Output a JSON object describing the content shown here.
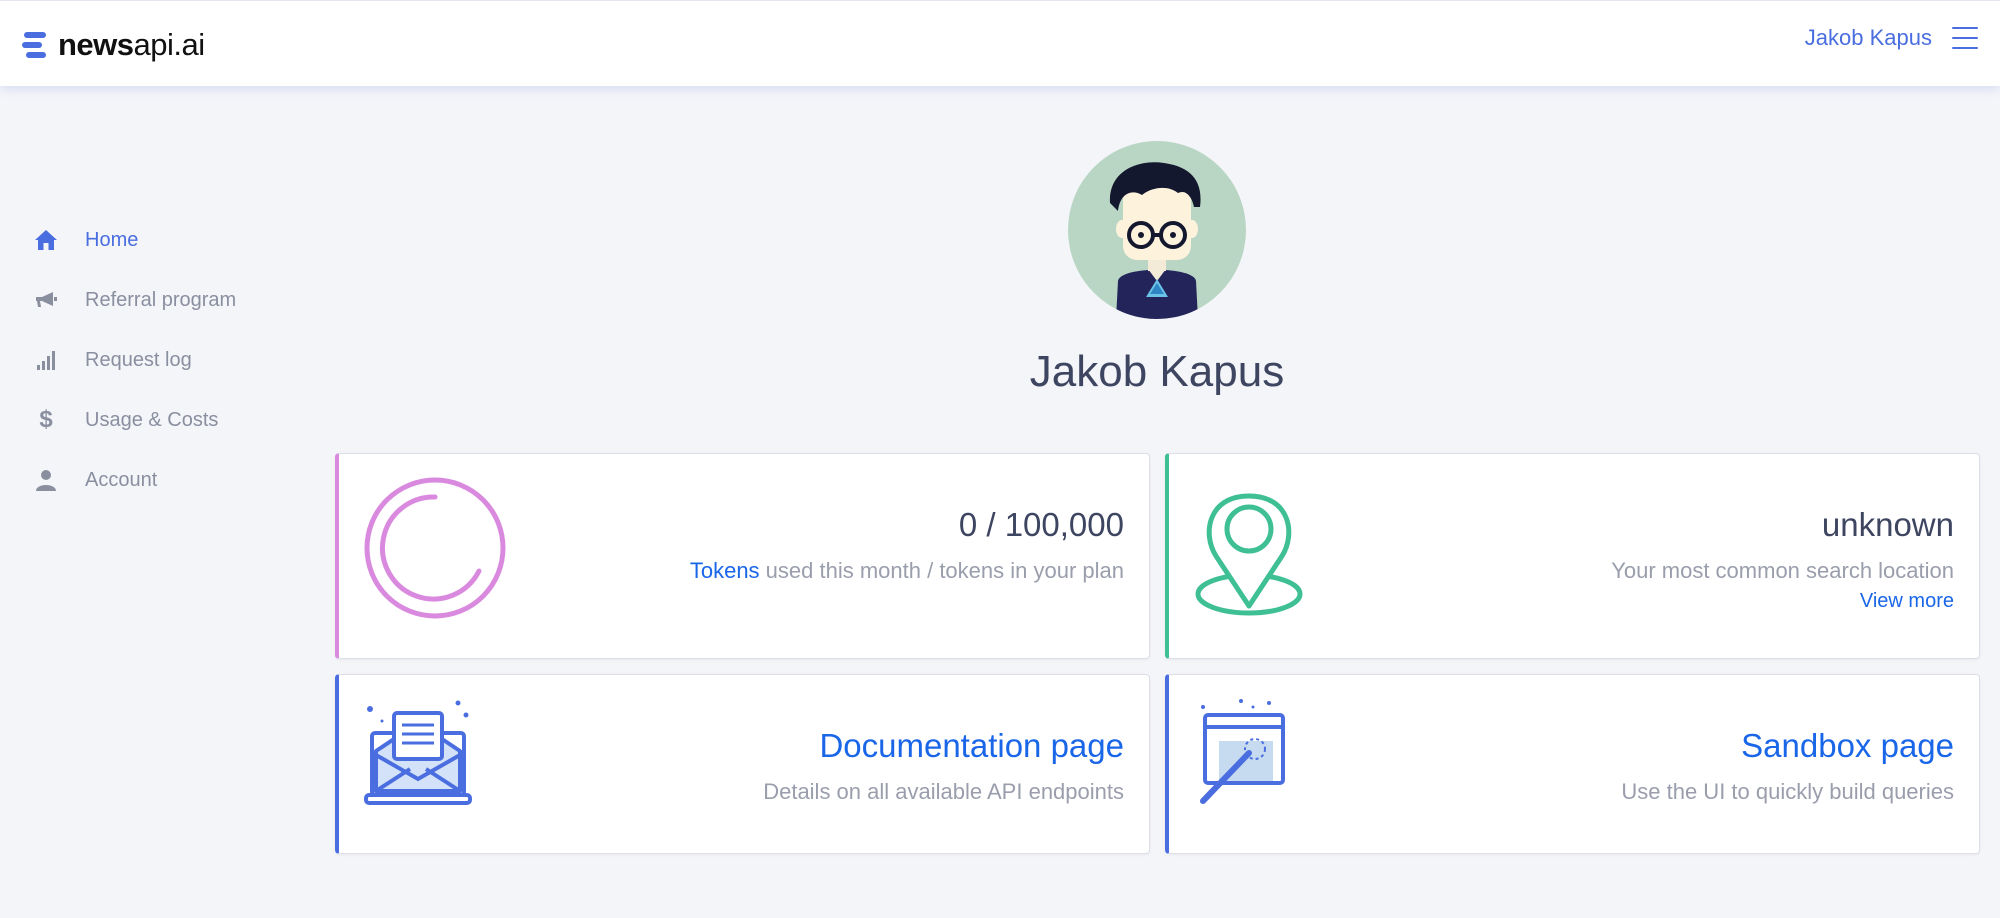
{
  "header": {
    "logo_bold": "news",
    "logo_rest": "api.ai",
    "user_name": "Jakob Kapus"
  },
  "sidebar": {
    "items": [
      {
        "label": "Home",
        "icon": "home-icon",
        "active": true
      },
      {
        "label": "Referral program",
        "icon": "megaphone-icon",
        "active": false
      },
      {
        "label": "Request log",
        "icon": "bar-chart-icon",
        "active": false
      },
      {
        "label": "Usage & Costs",
        "icon": "dollar-icon",
        "active": false
      },
      {
        "label": "Account",
        "icon": "user-icon",
        "active": false
      }
    ]
  },
  "profile": {
    "name": "Jakob Kapus"
  },
  "cards": {
    "tokens": {
      "value": "0 / 100,000",
      "desc_link": "Tokens",
      "desc_rest": " used this month / tokens in your plan",
      "used_fraction": 0,
      "icon": "circle-progress-icon"
    },
    "location": {
      "value": "unknown",
      "desc": "Your most common search location",
      "link": "View more",
      "icon": "location-pin-icon"
    },
    "documentation": {
      "title": "Documentation page",
      "desc": "Details on all available API endpoints",
      "icon": "envelope-laptop-icon"
    },
    "sandbox": {
      "title": "Sandbox page",
      "desc": "Use the UI to quickly build queries",
      "icon": "magic-wand-icon"
    }
  },
  "colors": {
    "accent": "#4a6ee0",
    "link": "#1a66e8",
    "tokens_border": "#d98adf",
    "location_border": "#3fbf94",
    "background": "#f4f5f9"
  }
}
